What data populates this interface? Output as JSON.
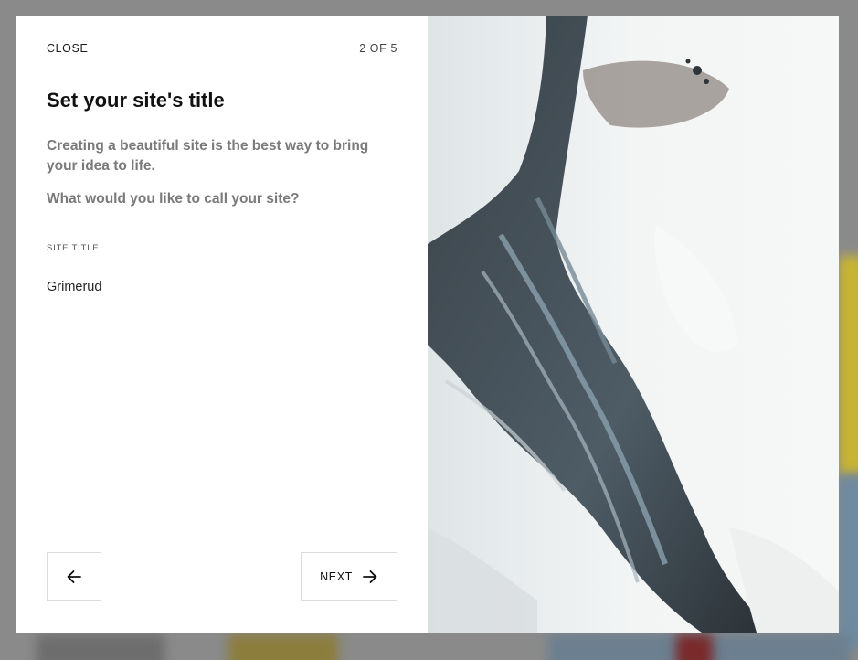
{
  "modal": {
    "close_label": "CLOSE",
    "step_label": "2 OF 5",
    "title": "Set your site's title",
    "description": "Creating a beautiful site is the best way to bring your idea to life.",
    "question": "What would you like to call your site?",
    "field_label": "SITE TITLE",
    "field_value": "Grimerud",
    "next_label": "NEXT"
  },
  "icons": {
    "back": "arrow-left-icon",
    "next": "arrow-right-icon"
  },
  "colors": {
    "backdrop": "#8a8a8a",
    "text_primary": "#111111",
    "text_muted": "#7a7a7a",
    "border": "#dcdcdc"
  }
}
